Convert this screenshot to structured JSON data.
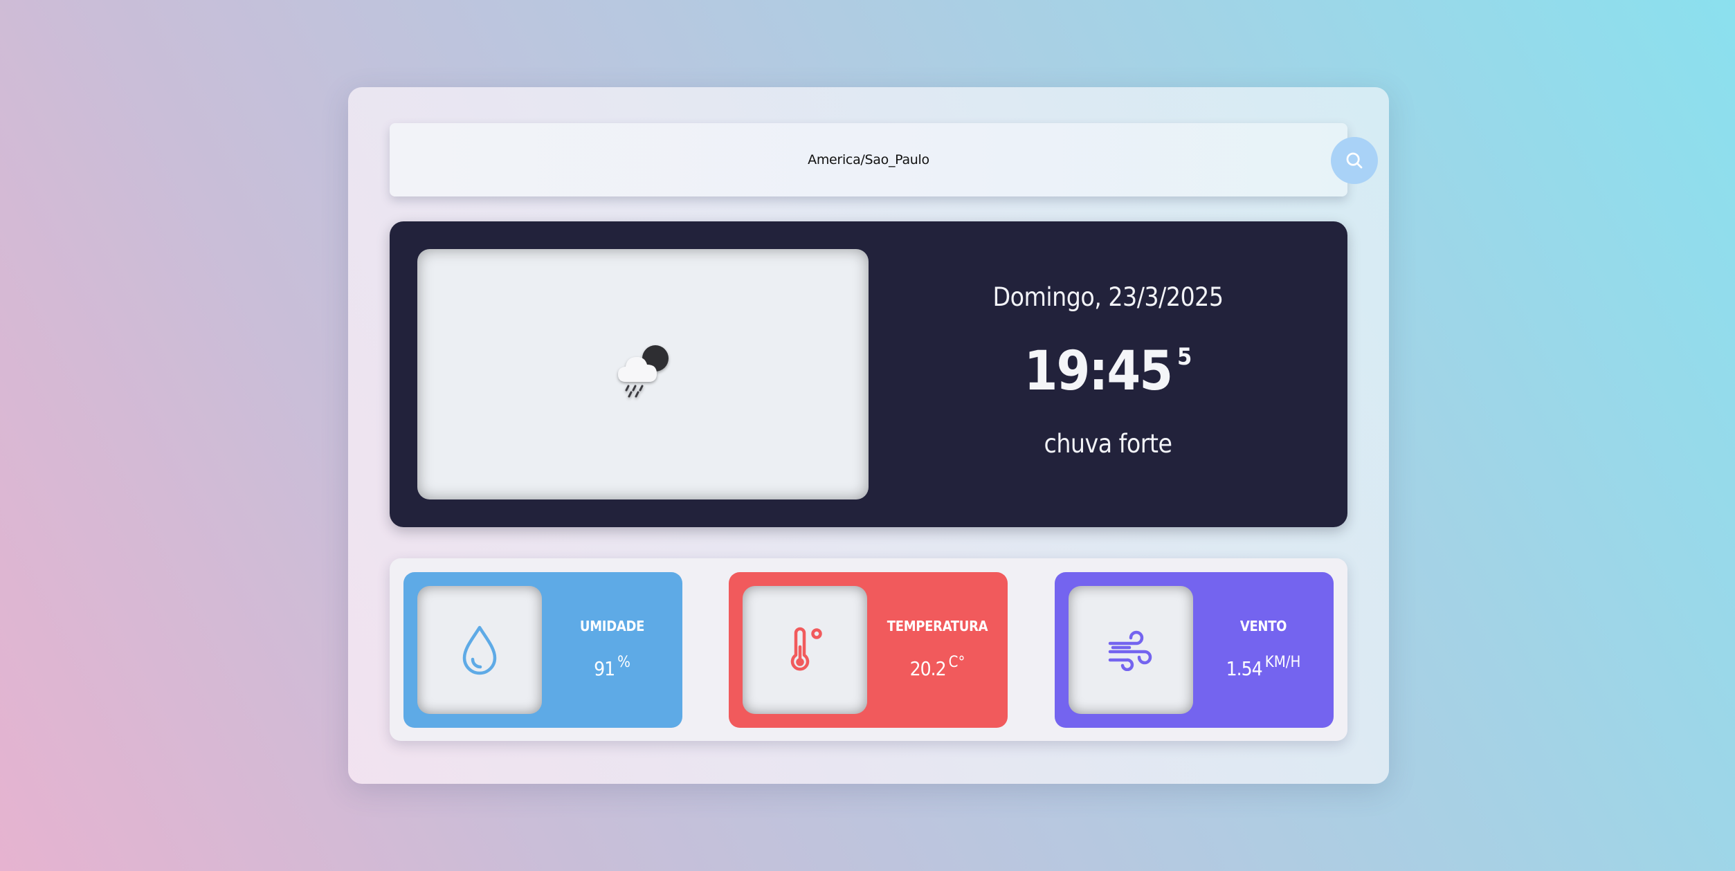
{
  "search": {
    "value": "America/Sao_Paulo",
    "button_icon": "search-icon"
  },
  "current": {
    "icon": "cloud-rain-moon-icon",
    "date": "Domingo, 23/3/2025",
    "time": "19:45",
    "seconds": "5",
    "condition": "chuva forte"
  },
  "stats": {
    "humidity": {
      "icon": "water-drop-icon",
      "title": "UMIDADE",
      "value": "91",
      "unit": "%",
      "color": "#5eaae6"
    },
    "temperature": {
      "icon": "thermometer-icon",
      "title": "TEMPERATURA",
      "value": "20.2",
      "unit": "C°",
      "color": "#f15a5c"
    },
    "wind": {
      "icon": "wind-icon",
      "title": "VENTO",
      "value": "1.54",
      "unit": "KM/H",
      "color": "#7464ef"
    }
  },
  "colors": {
    "main_card": "#22223b",
    "search_button": "#a9d2f7"
  }
}
